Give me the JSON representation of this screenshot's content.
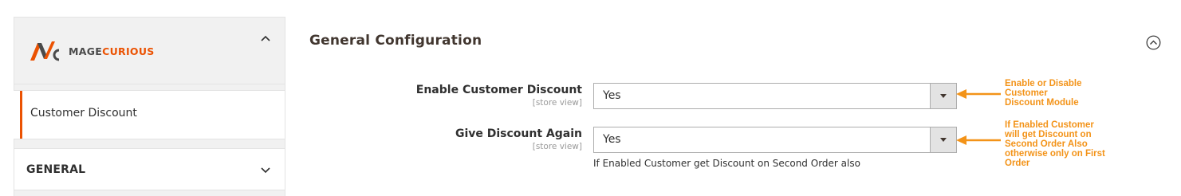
{
  "sidebar": {
    "brand": {
      "text_part1": "MAGE",
      "text_part2": "CURIOUS"
    },
    "active_item_label": "Customer Discount",
    "general_label": "GENERAL"
  },
  "section": {
    "title": "General Configuration"
  },
  "fields": [
    {
      "label": "Enable Customer Discount",
      "scope": "[store view]",
      "value": "Yes"
    },
    {
      "label": "Give Discount Again",
      "scope": "[store view]",
      "value": "Yes",
      "note": "If Enabled Customer get Discount on Second Order also"
    }
  ],
  "annotations": [
    {
      "text": "Enable or Disable\nCustomer\nDiscount Module"
    },
    {
      "text": "If Enabled Customer\nwill get Discount on\nSecond Order Also\notherwise only on First\nOrder"
    }
  ],
  "colors": {
    "accent": "#eb5202",
    "annotation": "#f39318"
  }
}
